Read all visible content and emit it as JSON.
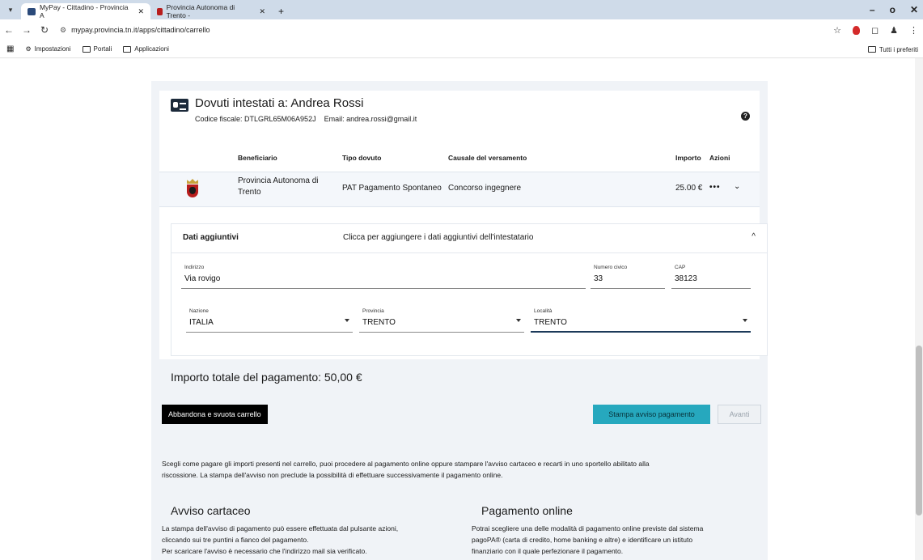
{
  "browser": {
    "tabs": [
      {
        "title": "MyPay - Cittadino - Provincia A",
        "active": true
      },
      {
        "title": "Provincia Autonoma di Trento -",
        "active": false
      }
    ],
    "url": "mypay.provincia.tn.it/apps/cittadino/carrello",
    "bookmarks": [
      "Impostazioni",
      "Portali",
      "Applicazioni"
    ],
    "bookmarks_right": "Tutti i preferiti"
  },
  "owner": {
    "title": "Dovuti intestati a: Andrea Rossi",
    "codice_fiscale": "Codice fiscale: DTLGRL65M06A952J",
    "email": "Email: andrea.rossi@gmail.it"
  },
  "table": {
    "headers": {
      "beneficiario": "Beneficiario",
      "tipo": "Tipo dovuto",
      "causale": "Causale del versamento",
      "importo": "Importo",
      "azioni": "Azioni"
    },
    "row": {
      "beneficiario_line1": "Provincia Autonoma di",
      "beneficiario_line2": "Trento",
      "tipo": "PAT Pagamento Spontaneo",
      "causale": "Concorso ingegnere",
      "importo": "25.00 €",
      "azioni": "•••"
    }
  },
  "dati_aggiuntivi": {
    "title": "Dati aggiuntivi",
    "description": "Clicca per aggiungere i dati aggiuntivi dell'intestatario",
    "fields": {
      "indirizzo": {
        "label": "Indirizzo",
        "value": "Via rovigo"
      },
      "numero_civico": {
        "label": "Numero civico",
        "value": "33"
      },
      "cap": {
        "label": "CAP",
        "value": "38123"
      },
      "nazione": {
        "label": "Nazione",
        "value": "ITALIA"
      },
      "provincia": {
        "label": "Provincia",
        "value": "TRENTO"
      },
      "localita": {
        "label": "Località",
        "value": "TRENTO"
      }
    }
  },
  "totale": "Importo totale del pagamento: 50,00 €",
  "buttons": {
    "abbandona": "Abbandona e svuota carrello",
    "stampa": "Stampa avviso pagamento",
    "avanti": "Avanti"
  },
  "info": {
    "line1": "Scegli come pagare gli importi presenti nel carrello, puoi procedere al pagamento online oppure stampare l'avviso cartaceo e recarti in uno sportello abilitato alla",
    "line2": "riscossione. La stampa dell'avviso non preclude la possibilità di effettuare successivamente il pagamento online."
  },
  "avviso_cartaceo": {
    "title": "Avviso cartaceo",
    "line1": "La stampa dell'avviso di pagamento può essere effettuata dal pulsante azioni,",
    "line2": "cliccando sui tre puntini a fianco del pagamento.",
    "line3": "Per scaricare l'avviso è necessario che l'indirizzo mail sia verificato."
  },
  "pagamento_online": {
    "title": "Pagamento online",
    "line1": "Potrai scegliere una delle modalità di pagamento online previste dal sistema",
    "line2": "pagoPA® (carta di credito, home banking e altre) e identificare un istituto",
    "line3": "finanziario con il quale perfezionare il pagamento."
  },
  "colors": {
    "accent_teal": "#26a8be",
    "dark_button": "#000000",
    "panel_bg": "#f0f3f7",
    "tab_bar": "#cfdbe9"
  },
  "icons": [
    "chevron-down-icon",
    "chevron-up-icon",
    "help-icon",
    "id-card-icon",
    "crest-icon",
    "star-icon",
    "extension-icon",
    "profile-icon",
    "menu-icon",
    "back-icon",
    "forward-icon",
    "reload-icon",
    "folder-icon",
    "gear-icon"
  ]
}
